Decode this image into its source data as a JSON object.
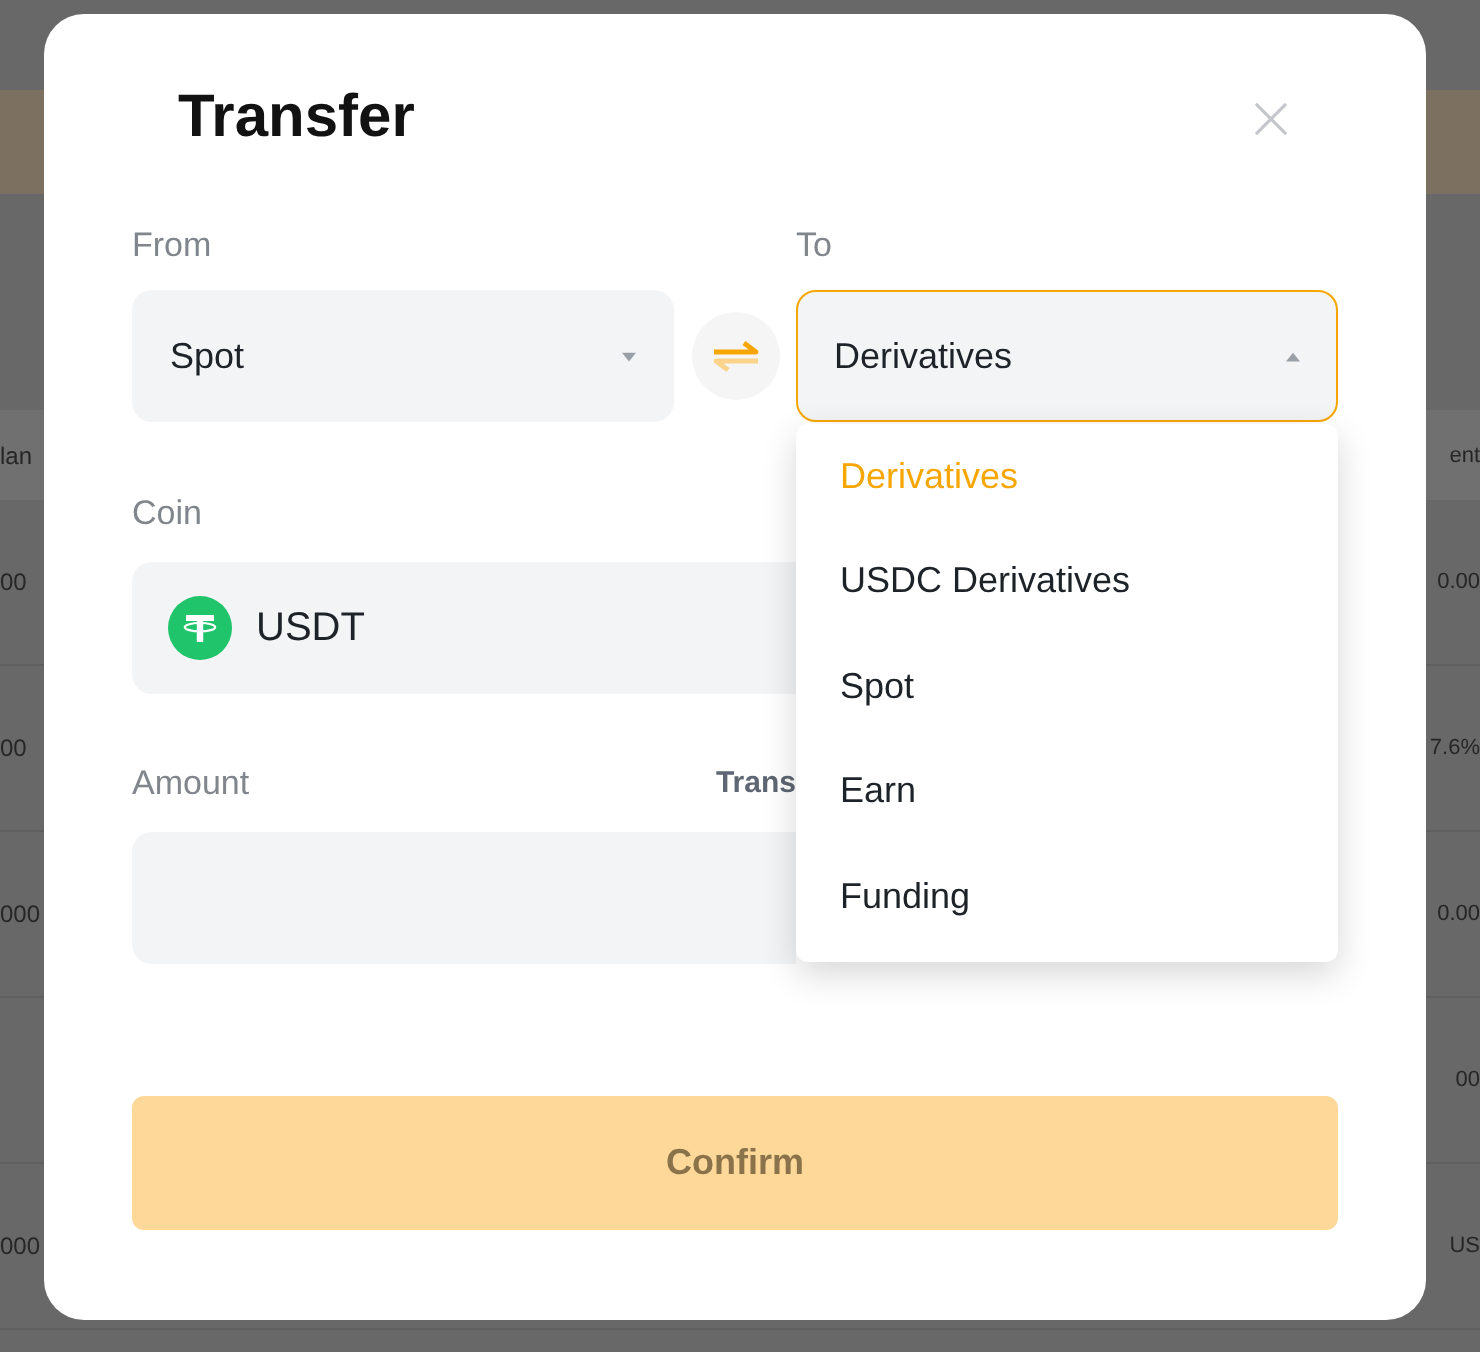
{
  "background_table": {
    "header": {
      "column_1": "lan",
      "column_2": "ent"
    },
    "rows": [
      {
        "column_1": "00",
        "column_2": "0.00"
      },
      {
        "column_1": "00",
        "column_2": "7.6%"
      },
      {
        "column_1": "000",
        "column_2": "0.00"
      },
      {
        "column_2": "00"
      },
      {
        "column_1": "000",
        "column_2": "US"
      }
    ]
  },
  "dialog": {
    "title": "Transfer",
    "from": {
      "label": "From",
      "value": "Spot",
      "expanded": false
    },
    "to": {
      "label": "To",
      "value": "Derivatives",
      "expanded": true,
      "options": [
        {
          "label": "Derivatives",
          "selected": true
        },
        {
          "label": "USDC Derivatives",
          "selected": false
        },
        {
          "label": "Spot",
          "selected": false
        },
        {
          "label": "Earn",
          "selected": false
        },
        {
          "label": "Funding",
          "selected": false
        }
      ]
    },
    "coin": {
      "label": "Coin",
      "value": "USDT"
    },
    "amount": {
      "label": "Amount",
      "side_text": "Trans"
    },
    "confirm": {
      "label": "Confirm",
      "disabled": true
    }
  }
}
